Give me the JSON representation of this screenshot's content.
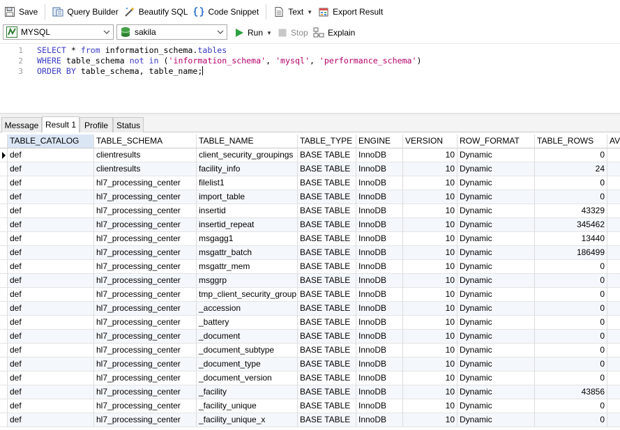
{
  "toolbar": {
    "save": "Save",
    "query_builder": "Query Builder",
    "beautify_sql": "Beautify SQL",
    "code_snippet": "Code Snippet",
    "text": "Text",
    "export_result": "Export Result"
  },
  "connection": {
    "db_type": "MYSQL",
    "database": "sakila",
    "run": "Run",
    "stop": "Stop",
    "explain": "Explain"
  },
  "editor": {
    "line_numbers": [
      "1",
      "2",
      "3"
    ]
  },
  "result_tabs": [
    "Message",
    "Result 1",
    "Profile",
    "Status"
  ],
  "active_tab": "Result 1",
  "grid": {
    "columns": [
      "TABLE_CATALOG",
      "TABLE_SCHEMA",
      "TABLE_NAME",
      "TABLE_TYPE",
      "ENGINE",
      "VERSION",
      "ROW_FORMAT",
      "TABLE_ROWS",
      "AV"
    ],
    "rows": [
      [
        "def",
        "clientresults",
        "client_security_groupings",
        "BASE TABLE",
        "InnoDB",
        "10",
        "Dynamic",
        "0"
      ],
      [
        "def",
        "clientresults",
        "facility_info",
        "BASE TABLE",
        "InnoDB",
        "10",
        "Dynamic",
        "24"
      ],
      [
        "def",
        "hl7_processing_center",
        "filelist1",
        "BASE TABLE",
        "InnoDB",
        "10",
        "Dynamic",
        "0"
      ],
      [
        "def",
        "hl7_processing_center",
        "import_table",
        "BASE TABLE",
        "InnoDB",
        "10",
        "Dynamic",
        "0"
      ],
      [
        "def",
        "hl7_processing_center",
        "insertid",
        "BASE TABLE",
        "InnoDB",
        "10",
        "Dynamic",
        "43329"
      ],
      [
        "def",
        "hl7_processing_center",
        "insertid_repeat",
        "BASE TABLE",
        "InnoDB",
        "10",
        "Dynamic",
        "345462"
      ],
      [
        "def",
        "hl7_processing_center",
        "msgagg1",
        "BASE TABLE",
        "InnoDB",
        "10",
        "Dynamic",
        "13440"
      ],
      [
        "def",
        "hl7_processing_center",
        "msgattr_batch",
        "BASE TABLE",
        "InnoDB",
        "10",
        "Dynamic",
        "186499"
      ],
      [
        "def",
        "hl7_processing_center",
        "msgattr_mem",
        "BASE TABLE",
        "InnoDB",
        "10",
        "Dynamic",
        "0"
      ],
      [
        "def",
        "hl7_processing_center",
        "msggrp",
        "BASE TABLE",
        "InnoDB",
        "10",
        "Dynamic",
        "0"
      ],
      [
        "def",
        "hl7_processing_center",
        "tmp_client_security_group",
        "BASE TABLE",
        "InnoDB",
        "10",
        "Dynamic",
        "0"
      ],
      [
        "def",
        "hl7_processing_center",
        "_accession",
        "BASE TABLE",
        "InnoDB",
        "10",
        "Dynamic",
        "0"
      ],
      [
        "def",
        "hl7_processing_center",
        "_battery",
        "BASE TABLE",
        "InnoDB",
        "10",
        "Dynamic",
        "0"
      ],
      [
        "def",
        "hl7_processing_center",
        "_document",
        "BASE TABLE",
        "InnoDB",
        "10",
        "Dynamic",
        "0"
      ],
      [
        "def",
        "hl7_processing_center",
        "_document_subtype",
        "BASE TABLE",
        "InnoDB",
        "10",
        "Dynamic",
        "0"
      ],
      [
        "def",
        "hl7_processing_center",
        "_document_type",
        "BASE TABLE",
        "InnoDB",
        "10",
        "Dynamic",
        "0"
      ],
      [
        "def",
        "hl7_processing_center",
        "_document_version",
        "BASE TABLE",
        "InnoDB",
        "10",
        "Dynamic",
        "0"
      ],
      [
        "def",
        "hl7_processing_center",
        "_facility",
        "BASE TABLE",
        "InnoDB",
        "10",
        "Dynamic",
        "43856"
      ],
      [
        "def",
        "hl7_processing_center",
        "_facility_unique",
        "BASE TABLE",
        "InnoDB",
        "10",
        "Dynamic",
        "0"
      ],
      [
        "def",
        "hl7_processing_center",
        "_facility_unique_x",
        "BASE TABLE",
        "InnoDB",
        "10",
        "Dynamic",
        "0"
      ]
    ]
  }
}
